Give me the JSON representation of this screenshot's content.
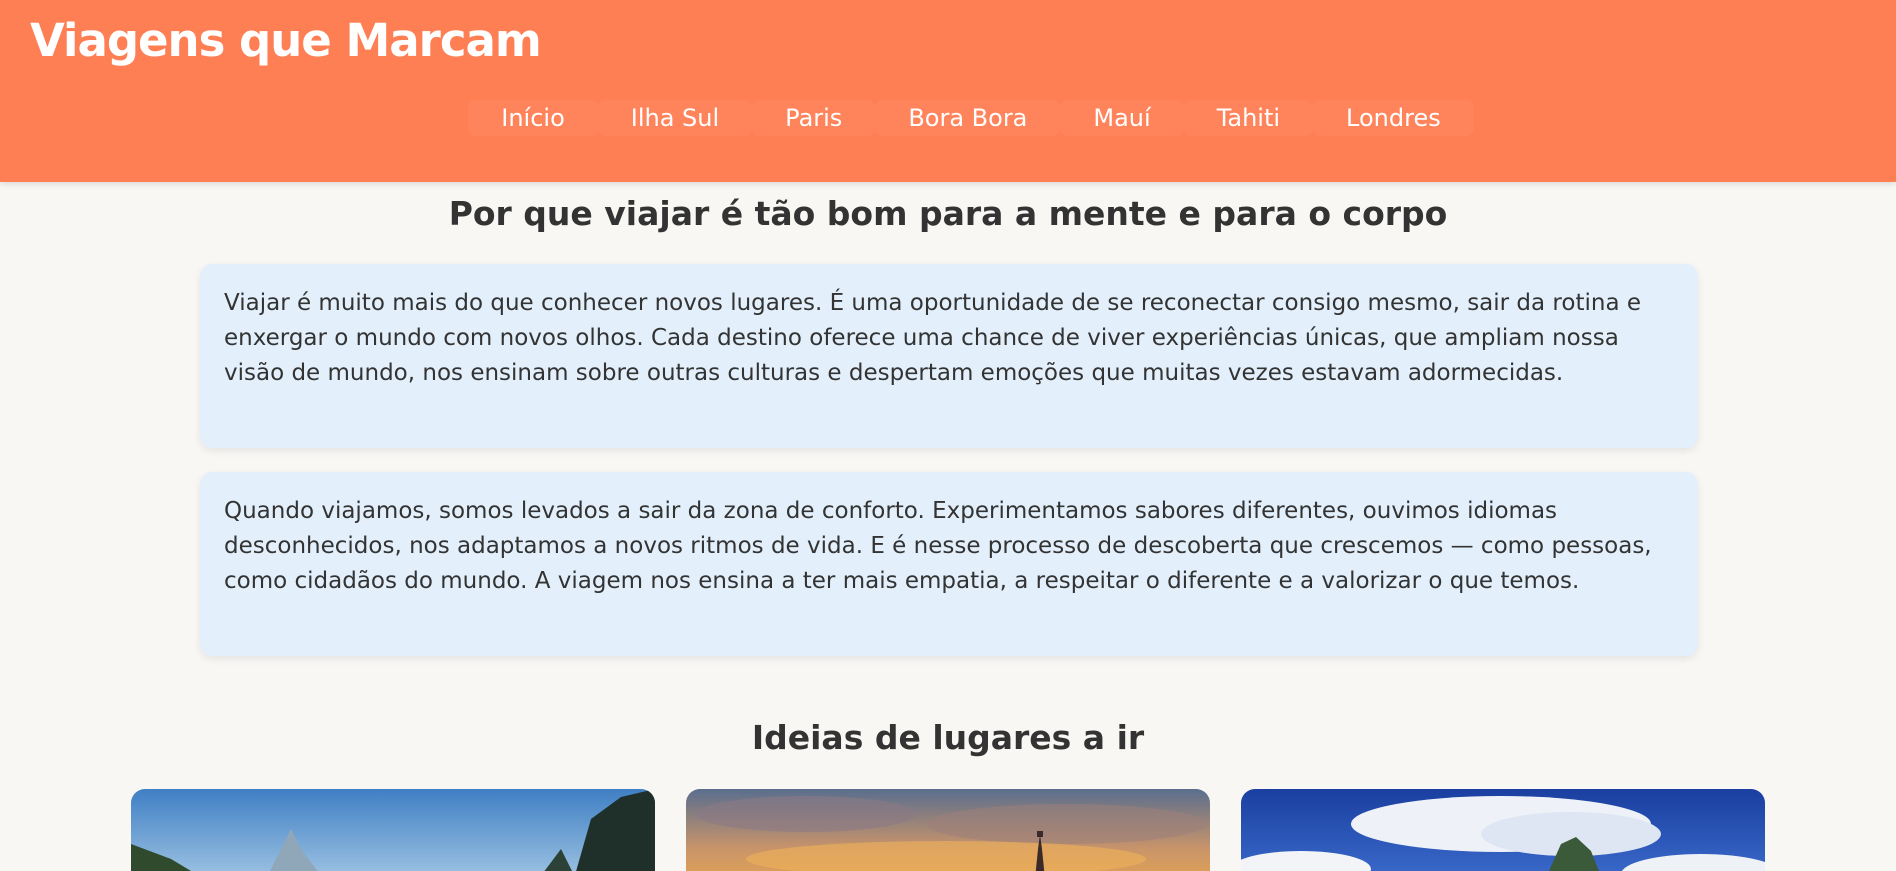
{
  "header": {
    "site_title": "Viagens que Marcam",
    "nav": [
      "Início",
      "Ilha Sul",
      "Paris",
      "Bora Bora",
      "Mauí",
      "Tahiti",
      "Londres"
    ]
  },
  "intro": {
    "title": "Por que viajar é tão bom para a mente e para o corpo",
    "paragraphs": [
      "Viajar é muito mais do que conhecer novos lugares. É uma oportunidade de se reconectar consigo mesmo, sair da rotina e enxergar o mundo com novos olhos. Cada destino oferece uma chance de viver experiências únicas, que ampliam nossa visão de mundo, nos ensinam sobre outras culturas e despertam emoções que muitas vezes estavam adormecidas.",
      "Quando viajamos, somos levados a sair da zona de conforto. Experimentamos sabores diferentes, ouvimos idiomas desconhecidos, nos adaptamos a novos ritmos de vida. E é nesse processo de descoberta que crescemos — como pessoas, como cidadãos do mundo. A viagem nos ensina a ter mais empatia, a respeitar o diferente e a valorizar o que temos."
    ]
  },
  "ideas": {
    "title": "Ideias de lugares a ir"
  },
  "colors": {
    "header_bg": "#ff7f55",
    "page_bg": "#f9f7f4",
    "card_bg": "#e3f0fb",
    "text": "#333333"
  }
}
